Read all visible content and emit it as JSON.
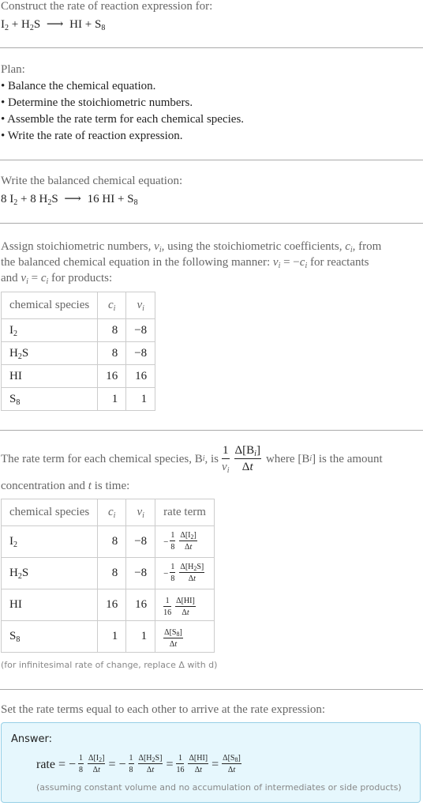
{
  "header": {
    "title": "Construct the rate of reaction expression for:",
    "reaction": {
      "reactants": [
        {
          "base": "I",
          "sub": "2"
        },
        {
          "base": "H",
          "sub": "2",
          "rest": "S"
        }
      ],
      "products": [
        {
          "base": "HI"
        },
        {
          "base": "S",
          "sub": "8"
        }
      ],
      "arrow": "⟶",
      "plus": "+"
    }
  },
  "plan": {
    "label": "Plan:",
    "steps": [
      "• Balance the chemical equation.",
      "• Determine the stoichiometric numbers.",
      "• Assemble the rate term for each chemical species.",
      "• Write the rate of reaction expression."
    ]
  },
  "balanced": {
    "label": "Write the balanced chemical equation:",
    "coef_I2": "8",
    "coef_H2S": "8",
    "coef_HI": "16",
    "arrow": "⟶",
    "plus": "+"
  },
  "stoich": {
    "line1": "Assign stoichiometric numbers, ",
    "nu_i": "ν",
    "i": "i",
    "line1b": ", using the stoichiometric coefficients, ",
    "c_i": "c",
    "line1c": ", from",
    "line2a": "the balanced chemical equation in the following manner: ",
    "line2b": " = −",
    "line2c": " for reactants",
    "line3a": "and ",
    "line3b": " = ",
    "line3c": " for products:",
    "headers": [
      "chemical species",
      "c",
      "ν"
    ],
    "rows": [
      {
        "species": "I",
        "sub": "2",
        "rest": "",
        "c": "8",
        "nu": "−8"
      },
      {
        "species": "H",
        "sub": "2",
        "rest": "S",
        "c": "8",
        "nu": "−8"
      },
      {
        "species": "HI",
        "sub": "",
        "rest": "",
        "c": "16",
        "nu": "16"
      },
      {
        "species": "S",
        "sub": "8",
        "rest": "",
        "c": "1",
        "nu": "1"
      }
    ]
  },
  "rate_terms": {
    "text1": "The rate term for each chemical species, B",
    "text1b": ", is ",
    "one": "1",
    "delta_B": "Δ[B",
    "delta_t": "Δt",
    "text2": " where [B",
    "text2b": "] is the amount",
    "text3a": "concentration and ",
    "t": "t",
    "text3b": " is time:",
    "headers": [
      "chemical species",
      "c",
      "ν",
      "rate term"
    ],
    "rows": [
      {
        "species": "I",
        "sub": "2",
        "rest": "",
        "c": "8",
        "nu": "−8",
        "sign": "−",
        "num": "1",
        "den": "8",
        "conc": "Δ[I",
        "conc_sub": "2",
        "conc_rest": "]"
      },
      {
        "species": "H",
        "sub": "2",
        "rest": "S",
        "c": "8",
        "nu": "−8",
        "sign": "−",
        "num": "1",
        "den": "8",
        "conc": "Δ[H",
        "conc_sub": "2",
        "conc_rest": "S]"
      },
      {
        "species": "HI",
        "sub": "",
        "rest": "",
        "c": "16",
        "nu": "16",
        "sign": "",
        "num": "1",
        "den": "16",
        "conc": "Δ[HI]",
        "conc_sub": "",
        "conc_rest": ""
      },
      {
        "species": "S",
        "sub": "8",
        "rest": "",
        "c": "1",
        "nu": "1",
        "sign": "",
        "num": "",
        "den": "",
        "conc": "Δ[S",
        "conc_sub": "8",
        "conc_rest": "]"
      }
    ],
    "dt": "Δt",
    "note": "(for infinitesimal rate of change, replace Δ with d)"
  },
  "final": {
    "label": "Set the rate terms equal to each other to arrive at the rate expression:",
    "answer_label": "Answer:",
    "rate_word": "rate",
    "equals": "=",
    "note": "(assuming constant volume and no accumulation of intermediates or side products)"
  }
}
